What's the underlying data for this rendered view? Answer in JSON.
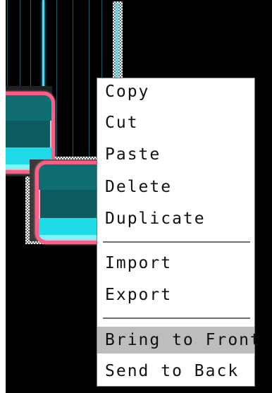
{
  "canvas": {
    "background": "#000000",
    "accent_wire": "#5ad7ee",
    "node_border": "#ff5f87",
    "node_fill": "#1fdbe8"
  },
  "context_menu": {
    "items": [
      {
        "label": "Copy"
      },
      {
        "label": "Cut"
      },
      {
        "label": "Paste"
      },
      {
        "label": "Delete"
      },
      {
        "label": "Duplicate"
      },
      {
        "label": "Import"
      },
      {
        "label": "Export"
      },
      {
        "label": "Bring to Front",
        "highlighted": true
      },
      {
        "label": "Send to Back"
      }
    ],
    "highlight_color": "#bdbdbd"
  }
}
